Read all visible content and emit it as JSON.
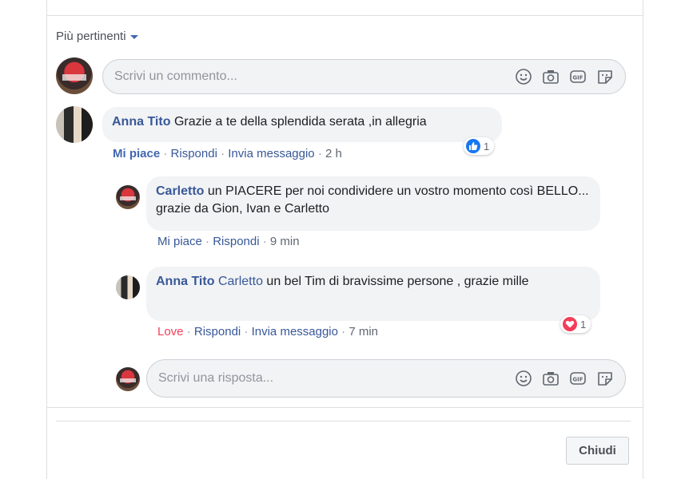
{
  "sort": {
    "label": "Più pertinenti"
  },
  "composer": {
    "placeholder": "Scrivi un commento..."
  },
  "comments": [
    {
      "author": "Anna Tito",
      "text": "Grazie a te della splendida serata ,in allegria",
      "actions": {
        "like": "Mi piace",
        "reply": "Rispondi",
        "message": "Invia messaggio",
        "time": "2 h"
      },
      "reaction": {
        "type": "like-icon",
        "count": "1",
        "color": "#1877f2"
      },
      "replies": [
        {
          "author": "Carletto",
          "text": "un PIACERE per noi condividere un vostro momento così BELLO... grazie da Gion, Ivan e Carletto",
          "actions": {
            "like": "Mi piace",
            "reply": "Rispondi",
            "time": "9 min"
          }
        },
        {
          "author": "Anna Tito",
          "mention": "Carletto",
          "text": "un bel Tim di bravissime persone , grazie mille",
          "actions": {
            "like": "Love",
            "reply": "Rispondi",
            "message": "Invia messaggio",
            "time": "7 min"
          },
          "reaction": {
            "type": "love-icon",
            "count": "1",
            "color": "#f33e58"
          }
        }
      ]
    }
  ],
  "reply_composer": {
    "placeholder": "Scrivi una risposta..."
  },
  "footer": {
    "close_label": "Chiudi"
  },
  "colors": {
    "link": "#385898",
    "accent": "#4267b2",
    "love": "#f33e58"
  }
}
